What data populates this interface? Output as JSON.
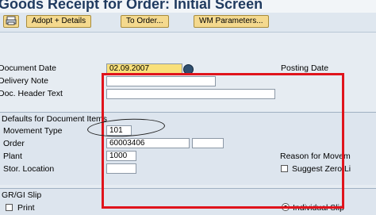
{
  "window": {
    "title": "Goods Receipt for Order: Initial Screen"
  },
  "toolbar": {
    "icon_button": "print-icon",
    "adopt_details": "Adopt + Details",
    "to_order": "To Order...",
    "wm_parameters": "WM Parameters..."
  },
  "header": {
    "document_date_label": "Document Date",
    "document_date_value": "02.09.2007",
    "posting_date_label": "Posting Date",
    "delivery_note_label": "Delivery Note",
    "doc_header_text_label": "Doc. Header Text"
  },
  "defaults": {
    "title": "Defaults for Document Items",
    "movement_type_label": "Movement Type",
    "movement_type_value": "101",
    "order_label": "Order",
    "order_value": "60003406",
    "plant_label": "Plant",
    "plant_value": "1000",
    "stor_location_label": "Stor. Location",
    "reason_label": "Reason for Movem",
    "suggest_zero_label": "Suggest Zero Li"
  },
  "grgi": {
    "title": "GR/GI Slip",
    "print_label": "Print",
    "individual_slip_label": "Individual Slip",
    "individual_slip_selected": true
  },
  "colors": {
    "highlight_box": "#e0141c",
    "date_field": "#f9e07a",
    "button": "#f4d98e"
  }
}
